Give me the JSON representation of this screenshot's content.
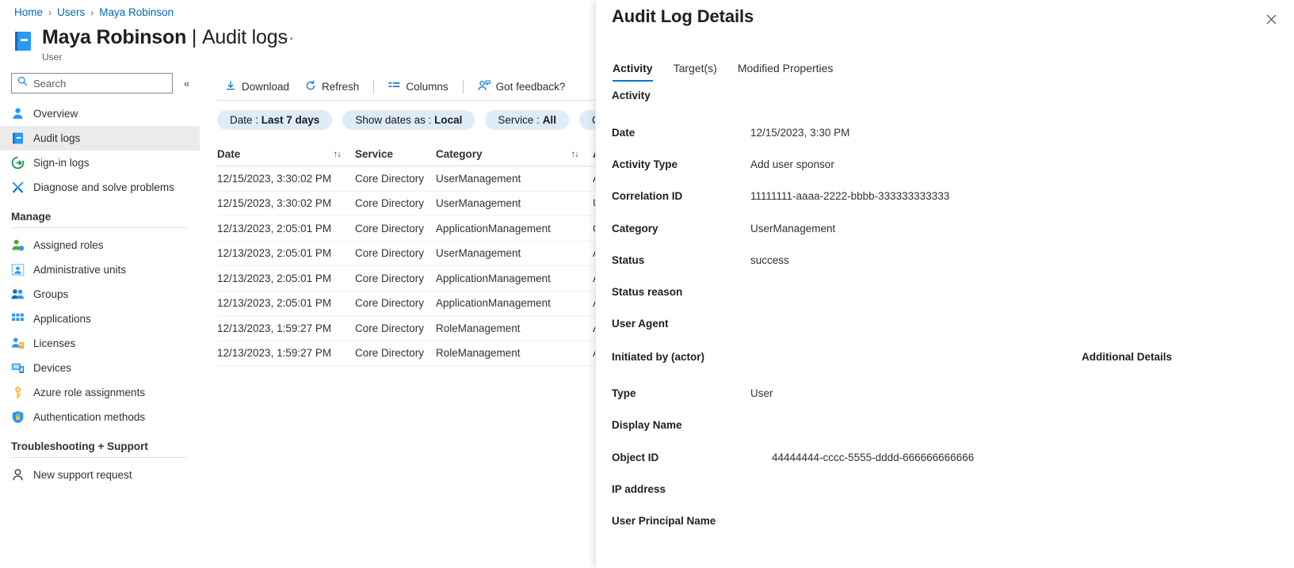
{
  "breadcrumb": {
    "items": [
      "Home",
      "Users",
      "Maya Robinson"
    ],
    "separator": "›"
  },
  "header": {
    "title_name": "Maya Robinson",
    "title_divider": "|",
    "title_page": "Audit logs",
    "subtitle": "User",
    "more_label": "⋯",
    "icon": "user-book-icon"
  },
  "sidebar": {
    "search": {
      "placeholder": "Search",
      "value": "",
      "icon": "search-icon"
    },
    "collapse": {
      "label": "«",
      "icon": "collapse-chevrons-icon"
    },
    "items": [
      {
        "label": "Overview",
        "icon": "person-icon",
        "selected": false
      },
      {
        "label": "Audit logs",
        "icon": "book-icon",
        "selected": true
      },
      {
        "label": "Sign-in logs",
        "icon": "sign-in-arrow-icon",
        "selected": false
      },
      {
        "label": "Diagnose and solve problems",
        "icon": "wrench-icon",
        "selected": false
      }
    ],
    "groups": [
      {
        "label": "Manage",
        "items": [
          {
            "label": "Assigned roles",
            "icon": "person-badge-icon"
          },
          {
            "label": "Administrative units",
            "icon": "admin-unit-icon"
          },
          {
            "label": "Groups",
            "icon": "people-icon"
          },
          {
            "label": "Applications",
            "icon": "grid-apps-icon"
          },
          {
            "label": "Licenses",
            "icon": "license-person-icon"
          },
          {
            "label": "Devices",
            "icon": "devices-icon"
          },
          {
            "label": "Azure role assignments",
            "icon": "key-icon"
          },
          {
            "label": "Authentication methods",
            "icon": "shield-lock-icon"
          }
        ]
      },
      {
        "label": "Troubleshooting + Support",
        "items": [
          {
            "label": "New support request",
            "icon": "support-person-icon"
          }
        ]
      }
    ]
  },
  "toolbar": {
    "buttons": [
      {
        "label": "Download",
        "icon": "download-icon"
      },
      {
        "label": "Refresh",
        "icon": "refresh-icon"
      },
      {
        "label": "Columns",
        "icon": "columns-icon"
      },
      {
        "label": "Got feedback?",
        "icon": "feedback-person-icon"
      }
    ]
  },
  "filters": [
    {
      "prefix": "Date : ",
      "value": "Last 7 days"
    },
    {
      "prefix": "Show dates as : ",
      "value": "Local"
    },
    {
      "prefix": "Service : ",
      "value": "All"
    },
    {
      "prefix": "Categor",
      "value": ""
    }
  ],
  "table": {
    "columns": [
      {
        "label": "Date",
        "sortable": true,
        "sort_icon": "↑↓"
      },
      {
        "label": "Service",
        "sortable": false,
        "sort_icon": ""
      },
      {
        "label": "Category",
        "sortable": true,
        "sort_icon": "↑↓"
      },
      {
        "label": "Activ",
        "sortable": false,
        "sort_icon": ""
      }
    ],
    "rows": [
      {
        "date": "12/15/2023, 3:30:02 PM",
        "service": "Core Directory",
        "category": "UserManagement",
        "activity": "Add"
      },
      {
        "date": "12/15/2023, 3:30:02 PM",
        "service": "Core Directory",
        "category": "UserManagement",
        "activity": "Upda"
      },
      {
        "date": "12/13/2023, 2:05:01 PM",
        "service": "Core Directory",
        "category": "ApplicationManagement",
        "activity": "Cons"
      },
      {
        "date": "12/13/2023, 2:05:01 PM",
        "service": "Core Directory",
        "category": "UserManagement",
        "activity": "Add"
      },
      {
        "date": "12/13/2023, 2:05:01 PM",
        "service": "Core Directory",
        "category": "ApplicationManagement",
        "activity": "Add"
      },
      {
        "date": "12/13/2023, 2:05:01 PM",
        "service": "Core Directory",
        "category": "ApplicationManagement",
        "activity": "Add"
      },
      {
        "date": "12/13/2023, 1:59:27 PM",
        "service": "Core Directory",
        "category": "RoleManagement",
        "activity": "Add"
      },
      {
        "date": "12/13/2023, 1:59:27 PM",
        "service": "Core Directory",
        "category": "RoleManagement",
        "activity": "Add"
      }
    ]
  },
  "panel": {
    "title": "Audit Log Details",
    "close_icon": "close-icon",
    "tabs": [
      {
        "label": "Activity",
        "active": true
      },
      {
        "label": "Target(s)",
        "active": false
      },
      {
        "label": "Modified Properties",
        "active": false
      }
    ],
    "activity_section": "Activity",
    "additional_details_section": "Additional Details",
    "initiated_by_section": "Initiated by (actor)",
    "activity_fields": [
      {
        "key": "Date",
        "value": "12/15/2023, 3:30 PM"
      },
      {
        "key": "Activity Type",
        "value": "Add user sponsor"
      },
      {
        "key": "Correlation ID",
        "value": "11111111-aaaa-2222-bbbb-333333333333"
      },
      {
        "key": "Category",
        "value": "UserManagement"
      },
      {
        "key": "Status",
        "value": "success"
      },
      {
        "key": "Status reason",
        "value": ""
      },
      {
        "key": "User Agent",
        "value": ""
      }
    ],
    "actor_fields": [
      {
        "key": "Type",
        "value": "User"
      },
      {
        "key": "Display Name",
        "value": ""
      },
      {
        "key": "Object ID",
        "value": "44444444-cccc-5555-dddd-666666666666"
      },
      {
        "key": "IP address",
        "value": ""
      },
      {
        "key": "User Principal Name",
        "value": ""
      }
    ]
  },
  "colors": {
    "accent": "#0078d4",
    "link": "#0067b8",
    "chip_bg": "#deecf9",
    "selected_row": "#edebe9"
  }
}
